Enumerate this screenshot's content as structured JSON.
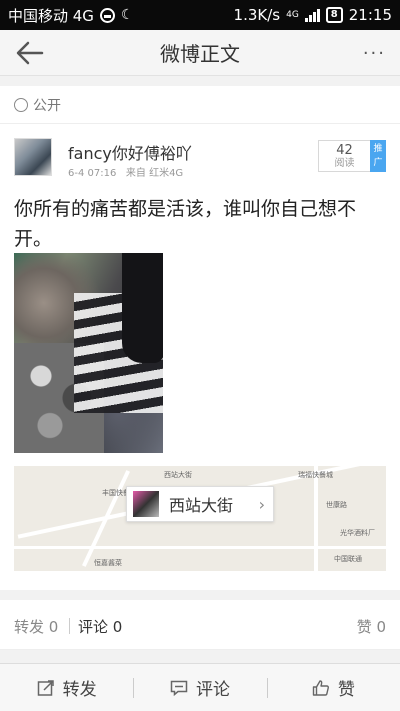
{
  "status_bar": {
    "carrier": "中国移动 4G",
    "speed": "1.3K/s",
    "net_tag": "4G",
    "battery": "8",
    "time": "21:15"
  },
  "nav": {
    "title": "微博正文",
    "more": "···"
  },
  "visibility": {
    "label": "公开"
  },
  "post": {
    "username": "fancy你好傅裕吖",
    "date": "6-4 07:16",
    "source": "来自 红米4G",
    "read_count": "42",
    "read_label": "阅读",
    "promote_label": "推广",
    "text": "你所有的痛苦都是活该，谁叫你自己想不开。"
  },
  "map": {
    "location_name": "西站大街",
    "labels": [
      "丰国快餐",
      "西站大街",
      "瑞福快餐城",
      "光华酒料厂",
      "恒嘉酱菜",
      "中国联通",
      "世康路"
    ]
  },
  "counts": {
    "repost": "转发 0",
    "comment": "评论 0",
    "like": "赞 0"
  },
  "toolbar": {
    "repost": "转发",
    "comment": "评论",
    "like": "赞"
  },
  "colors": {
    "accent_blue": "#4aa6f0",
    "status_bar": "#0a0a0a"
  }
}
